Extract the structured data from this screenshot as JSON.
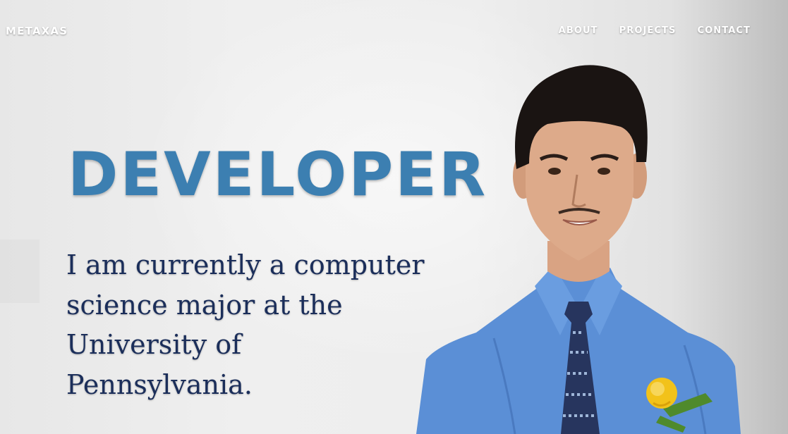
{
  "brand": {
    "name": "METAXAS"
  },
  "nav": {
    "items": [
      {
        "label": "ABOUT"
      },
      {
        "label": "PROJECTS"
      },
      {
        "label": "CONTACT"
      }
    ]
  },
  "hero": {
    "headline": "DEVELOPER",
    "intro": "I am currently a computer science major at the University of Pennsylvania."
  },
  "colors": {
    "headline": "#3c7fb1",
    "intro_text": "#1b2e5a",
    "nav_text": "#ffffff",
    "shirt": "#5b8fd6",
    "tie": "#1e2f5c",
    "rose": "#f2c21a"
  }
}
